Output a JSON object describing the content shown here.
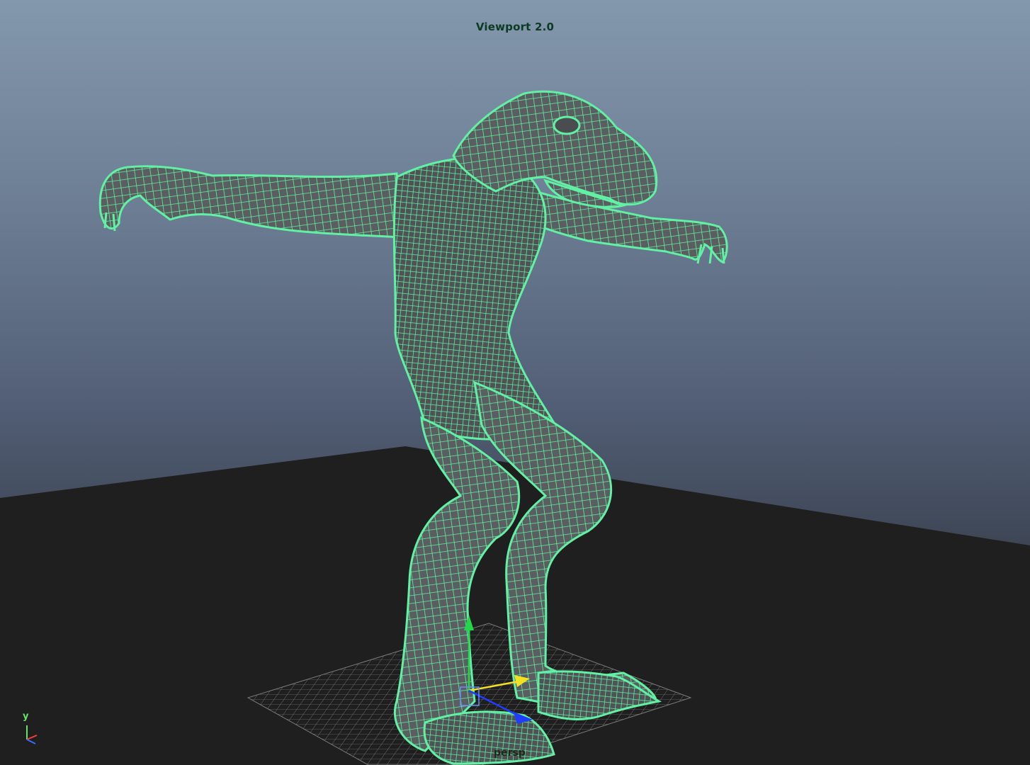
{
  "viewport": {
    "renderer_label": "Viewport 2.0",
    "camera_label": "persp",
    "axis_label_y": "y"
  },
  "colors": {
    "wireframe": "#62f0a4",
    "mesh_shade": "#5b5f62",
    "floor": "#1f1f1f",
    "grid": "#8a8a8a",
    "manipulator_y": "#22d84a",
    "manipulator_x": "#f2e022",
    "manipulator_z": "#1f3cff"
  },
  "icons": [
    "move-manipulator-icon",
    "axis-indicator-icon"
  ]
}
